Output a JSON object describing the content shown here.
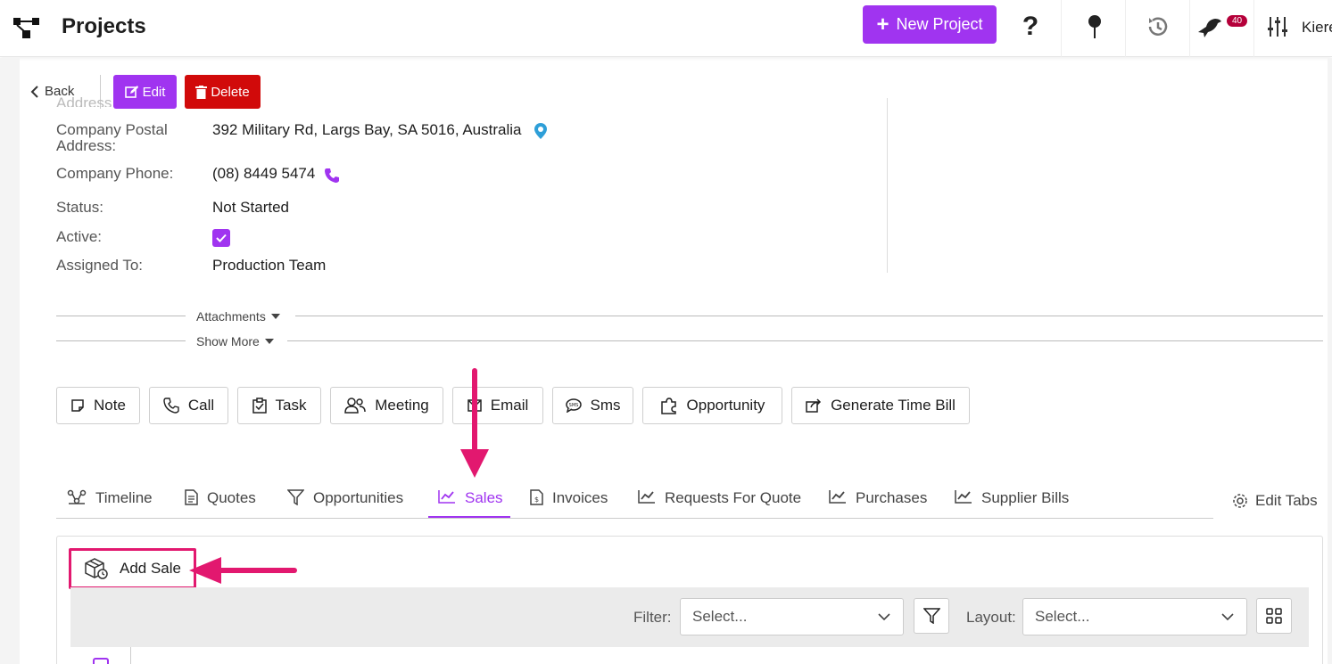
{
  "header": {
    "title": "Projects",
    "new_project_label": "New Project",
    "notification_count": "40",
    "user_name": "Kiere"
  },
  "actions": {
    "back_label": "Back",
    "edit_label": "Edit",
    "delete_label": "Delete"
  },
  "details": {
    "address_cut_label": "Address",
    "fields": [
      {
        "label": "Company Postal Address:",
        "value": "392 Military Rd, Largs Bay, SA 5016, Australia"
      },
      {
        "label": "Company Phone:",
        "value": "(08) 8449 5474"
      },
      {
        "label": "Status:",
        "value": "Not Started"
      },
      {
        "label": "Active:",
        "value": ""
      },
      {
        "label": "Assigned To:",
        "value": "Production Team"
      }
    ]
  },
  "sections": {
    "attachments_label": "Attachments",
    "show_more_label": "Show More"
  },
  "activity_buttons": [
    {
      "label": "Note",
      "icon": "note-icon"
    },
    {
      "label": "Call",
      "icon": "phone-icon"
    },
    {
      "label": "Task",
      "icon": "clipboard-check-icon"
    },
    {
      "label": "Meeting",
      "icon": "users-icon"
    },
    {
      "label": "Email",
      "icon": "mail-icon"
    },
    {
      "label": "Sms",
      "icon": "sms-icon"
    },
    {
      "label": "Opportunity",
      "icon": "puzzle-icon"
    },
    {
      "label": "Generate Time Bill",
      "icon": "share-icon"
    }
  ],
  "tabs": [
    {
      "label": "Timeline",
      "icon": "timeline-icon",
      "active": false
    },
    {
      "label": "Quotes",
      "icon": "document-icon",
      "active": false
    },
    {
      "label": "Opportunities",
      "icon": "filter-icon",
      "active": false
    },
    {
      "label": "Sales",
      "icon": "chart-icon",
      "active": true
    },
    {
      "label": "Invoices",
      "icon": "invoice-icon",
      "active": false
    },
    {
      "label": "Requests For Quote",
      "icon": "chart-icon",
      "active": false
    },
    {
      "label": "Purchases",
      "icon": "chart-icon",
      "active": false
    },
    {
      "label": "Supplier Bills",
      "icon": "chart-icon",
      "active": false
    }
  ],
  "edit_tabs_label": "Edit Tabs",
  "sales_panel": {
    "add_sale_label": "Add Sale",
    "filter_label": "Filter:",
    "filter_placeholder": "Select...",
    "layout_label": "Layout:",
    "layout_placeholder": "Select..."
  },
  "colors": {
    "accent": "#a034f0",
    "danger": "#d10a0a",
    "annotation": "#e2186f",
    "badge": "#b5003a"
  }
}
